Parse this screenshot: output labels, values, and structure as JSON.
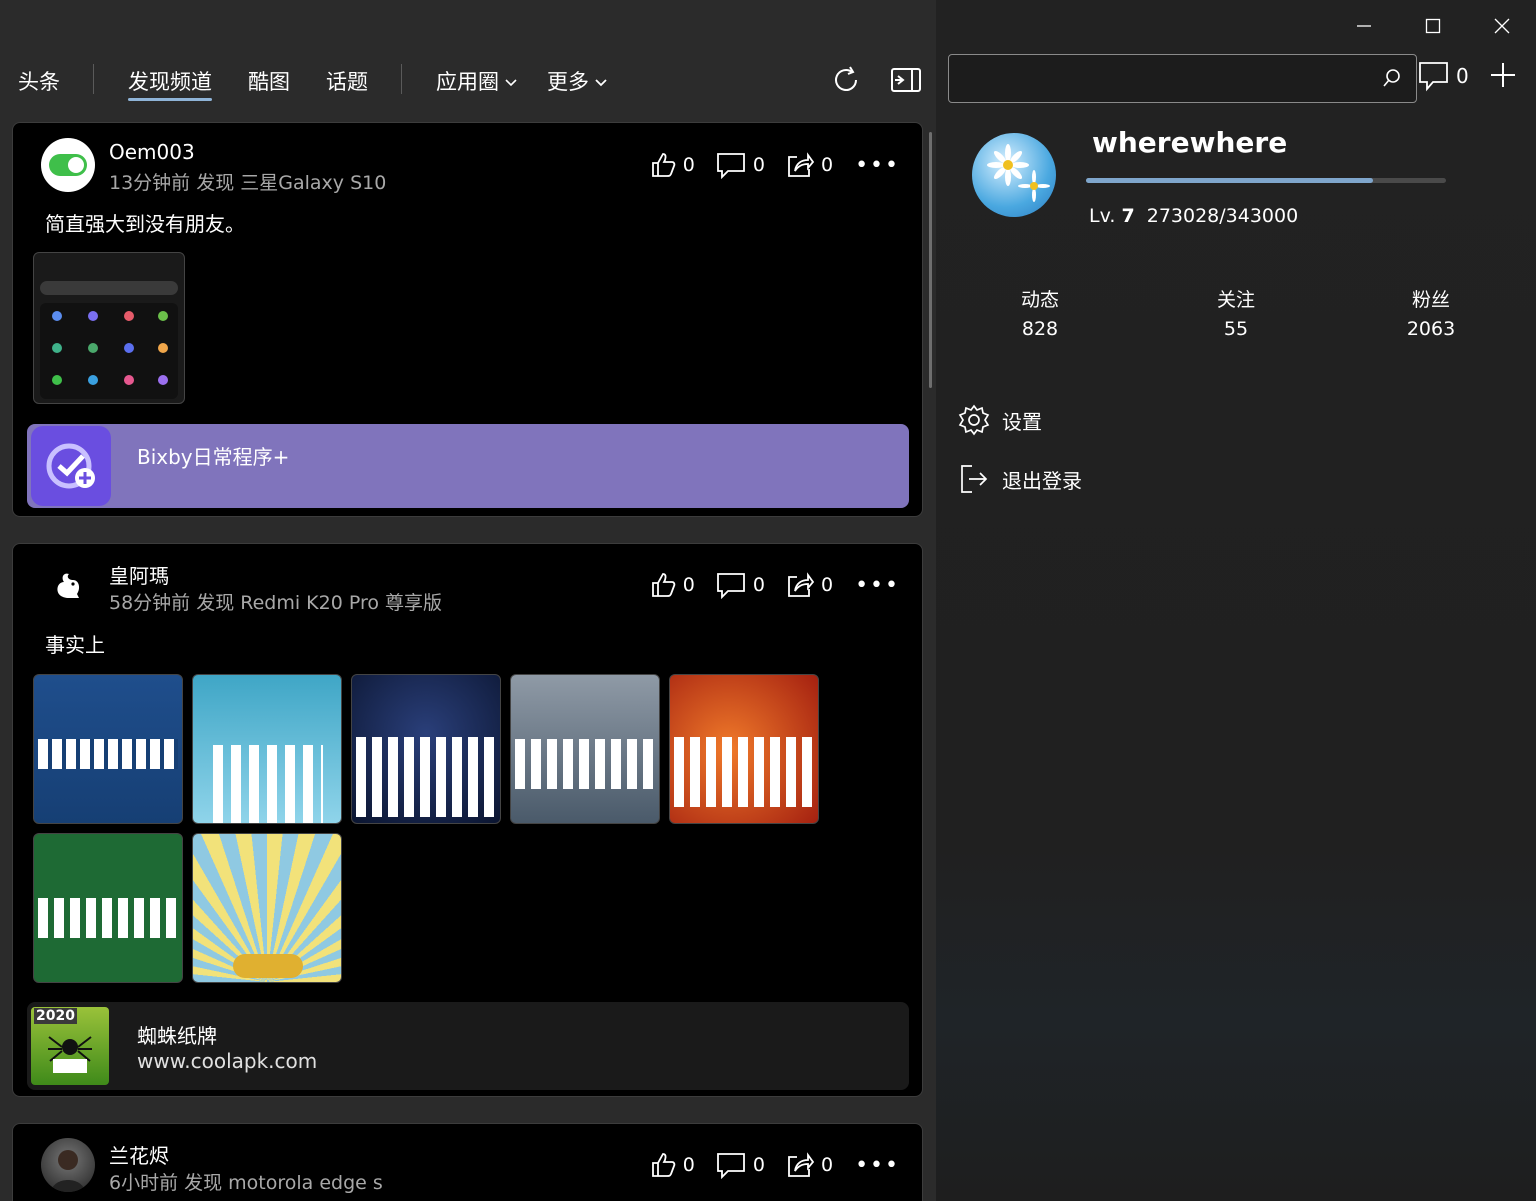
{
  "window": {
    "minimize": "—",
    "maximize": "☐",
    "close": "✕"
  },
  "nav": {
    "tabs": [
      "头条",
      "发现频道",
      "酷图",
      "话题",
      "应用圈",
      "更多"
    ],
    "active": "发现频道"
  },
  "search": {
    "value": "",
    "placeholder": ""
  },
  "messages": {
    "count": "0"
  },
  "profile": {
    "name": "wherewhere",
    "level_label": "Lv.",
    "level": "7",
    "exp": "273028/343000",
    "exp_fraction": 0.796,
    "stats": [
      {
        "label": "动态",
        "value": "828"
      },
      {
        "label": "关注",
        "value": "55"
      },
      {
        "label": "粉丝",
        "value": "2063"
      }
    ],
    "menu": {
      "settings": "设置",
      "logout": "退出登录"
    }
  },
  "posts": [
    {
      "user": "Oem003",
      "meta": "13分钟前  发现  三星Galaxy S10",
      "likes": "0",
      "comments": "0",
      "shares": "0",
      "text": "简直强大到没有朋友。",
      "app": {
        "name": "Bixby日常程序+",
        "url": "",
        "bg": "#8074bc"
      }
    },
    {
      "user": "皇阿瑪",
      "meta": "58分钟前  发现  Redmi K20 Pro 尊享版",
      "likes": "0",
      "comments": "0",
      "shares": "0",
      "text": "事实上",
      "app": {
        "name": "蜘蛛纸牌",
        "url": "www.coolapk.com",
        "bg": "#1a1a1a",
        "icon_text": "2020"
      }
    },
    {
      "user": "兰花烬",
      "meta": "6小时前  发现  motorola edge s",
      "likes": "0",
      "comments": "0",
      "shares": "0"
    }
  ]
}
